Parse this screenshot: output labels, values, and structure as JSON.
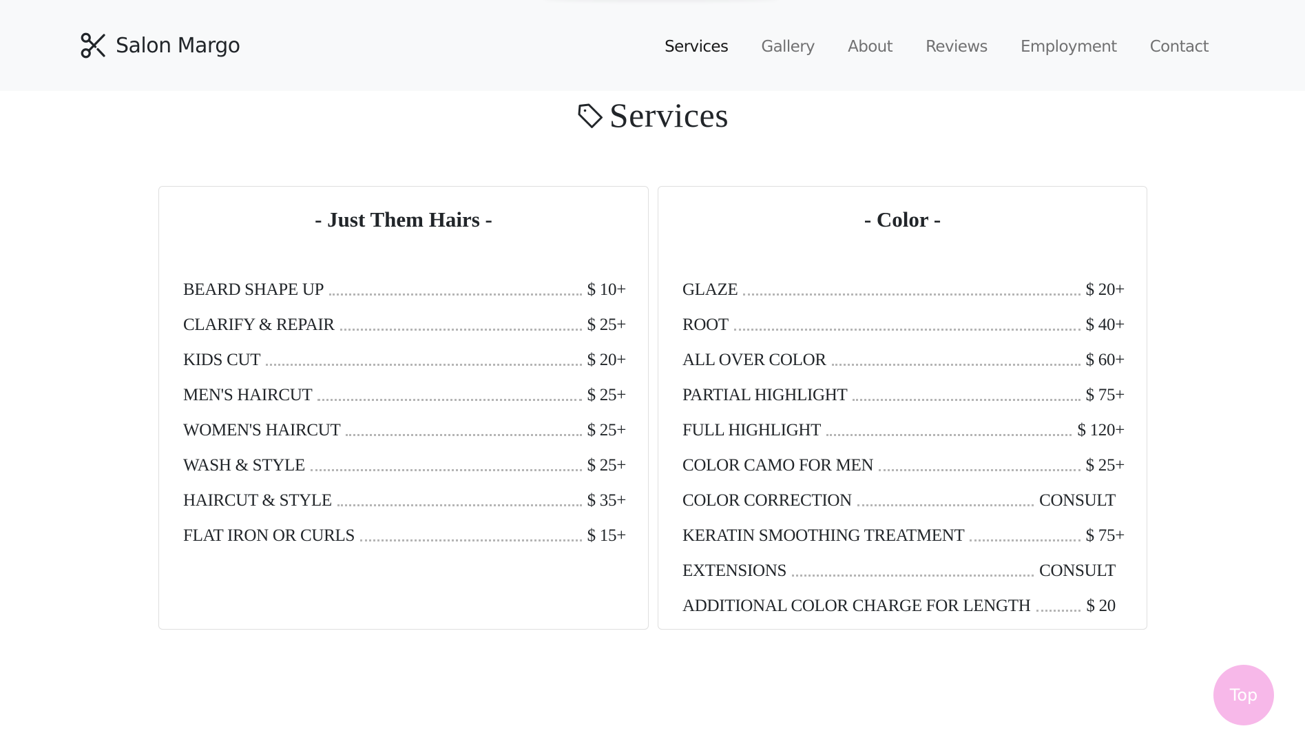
{
  "navbar": {
    "brand": {
      "name": "Salon Margo",
      "icon": "scissors-icon"
    },
    "links": [
      {
        "label": "Services",
        "active": true
      },
      {
        "label": "Gallery",
        "active": false
      },
      {
        "label": "About",
        "active": false
      },
      {
        "label": "Reviews",
        "active": false
      },
      {
        "label": "Employment",
        "active": false
      },
      {
        "label": "Contact",
        "active": false
      }
    ]
  },
  "section": {
    "title": "Services",
    "icon": "tag-icon"
  },
  "cards": [
    {
      "title": "- Just Them Hairs -",
      "items": [
        {
          "name": "BEARD SHAPE UP",
          "price": "$ 10+"
        },
        {
          "name": "CLARIFY & REPAIR",
          "price": "$ 25+"
        },
        {
          "name": "KIDS CUT",
          "price": "$ 20+"
        },
        {
          "name": "MEN'S HAIRCUT",
          "price": "$ 25+"
        },
        {
          "name": "WOMEN'S HAIRCUT",
          "price": "$ 25+"
        },
        {
          "name": "WASH & STYLE",
          "price": "$ 25+"
        },
        {
          "name": "HAIRCUT & STYLE",
          "price": "$ 35+"
        },
        {
          "name": "FLAT IRON OR CURLS",
          "price": "$ 15+"
        }
      ]
    },
    {
      "title": "- Color -",
      "items": [
        {
          "name": "GLAZE",
          "price": "$ 20+"
        },
        {
          "name": "ROOT",
          "price": "$ 40+"
        },
        {
          "name": "ALL OVER COLOR",
          "price": "$ 60+"
        },
        {
          "name": "PARTIAL HIGHLIGHT",
          "price": "$ 75+"
        },
        {
          "name": "FULL HIGHLIGHT",
          "price": "$ 120+"
        },
        {
          "name": "COLOR CAMO FOR MEN",
          "price": "$ 25+"
        },
        {
          "name": "COLOR CORRECTION",
          "price": "CONSULT"
        },
        {
          "name": "KERATIN SMOOTHING TREATMENT",
          "price": "$ 75+"
        },
        {
          "name": "EXTENSIONS",
          "price": "CONSULT"
        },
        {
          "name": "ADDITIONAL COLOR CHARGE FOR LENGTH",
          "price": "$ 20"
        }
      ]
    }
  ],
  "top_button": {
    "label": "Top"
  },
  "colors": {
    "navbar_bg": "#f8f9fa",
    "top_button_bg": "#f7b8e9",
    "text": "#212529",
    "nav_inactive": "#6c6c6c"
  }
}
